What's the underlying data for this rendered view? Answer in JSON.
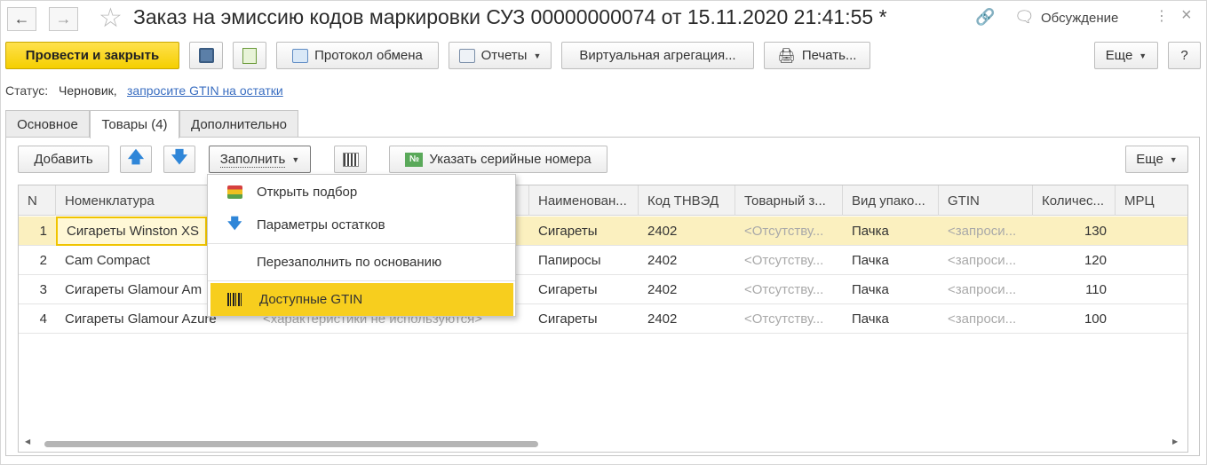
{
  "window": {
    "title": "Заказ на эмиссию кодов маркировки СУЗ 00000000074 от 15.11.2020 21:41:55 *",
    "discussion_label": "Обсуждение"
  },
  "toolbar": {
    "post_close": "Провести и закрыть",
    "exchange_protocol": "Протокол обмена",
    "reports": "Отчеты",
    "virtual_aggregation": "Виртуальная агрегация...",
    "print": "Печать...",
    "more": "Еще",
    "help": "?"
  },
  "status": {
    "label": "Статус:",
    "value": "Черновик,",
    "link": "запросите GTIN на остатки"
  },
  "tabs": [
    {
      "label": "Основное"
    },
    {
      "label": "Товары (4)"
    },
    {
      "label": "Дополнительно"
    }
  ],
  "goods_toolbar": {
    "add": "Добавить",
    "fill": "Заполнить",
    "serial": "Указать серийные номера",
    "more": "Еще"
  },
  "fill_menu": {
    "items": [
      {
        "label": "Открыть подбор"
      },
      {
        "label": "Параметры остатков"
      },
      {
        "label": "Перезаполнить по основанию"
      },
      {
        "label": "Доступные GTIN"
      }
    ]
  },
  "table": {
    "headers": [
      "N",
      "Номенклатура",
      "Наименован...",
      "Код ТНВЭД",
      "Товарный з...",
      "Вид упако...",
      "GTIN",
      "Количес...",
      "МРЦ"
    ],
    "rows": [
      {
        "n": "1",
        "name": "Сигареты Winston XS",
        "char": "",
        "title": "Сигареты",
        "tnved": "2402",
        "brand": "<Отсутству...",
        "pack": "Пачка",
        "gtin": "<запроси...",
        "qty": "130"
      },
      {
        "n": "2",
        "name": "Cam Compact",
        "char": "",
        "title": "Папиросы",
        "tnved": "2402",
        "brand": "<Отсутству...",
        "pack": "Пачка",
        "gtin": "<запроси...",
        "qty": "120"
      },
      {
        "n": "3",
        "name": "Сигареты Glamour Am",
        "char": "",
        "title": "Сигареты",
        "tnved": "2402",
        "brand": "<Отсутству...",
        "pack": "Пачка",
        "gtin": "<запроси...",
        "qty": "110"
      },
      {
        "n": "4",
        "name": "Сигареты Glamour Azure",
        "char": "<характеристики не используются>",
        "title": "Сигареты",
        "tnved": "2402",
        "brand": "<Отсутству...",
        "pack": "Пачка",
        "gtin": "<запроси...",
        "qty": "100"
      }
    ]
  },
  "colors": {
    "primary_button": "#f5cf00",
    "selected_row": "#fbf0bf",
    "menu_highlight": "#f7ce1e",
    "link": "#3a6ec1"
  }
}
